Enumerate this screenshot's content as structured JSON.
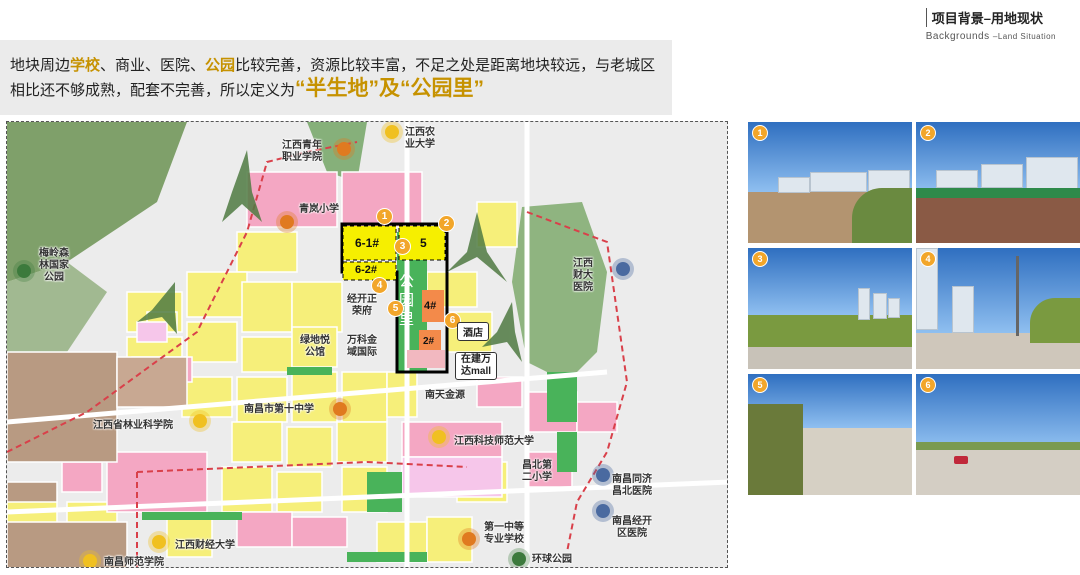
{
  "header": {
    "title": "项目背景–用地现状",
    "subtitle_main": "Backgrounds",
    "subtitle_small": "–Land Situation"
  },
  "intro": {
    "t1": "地块周边",
    "h1": "学校",
    "t2": "、商业、医院、",
    "h2": "公园",
    "t3": "比较完善，资源比较丰富，不足之处是距离地块较远，与老城区",
    "t4": "相比还不够成熟，配套不完善，所以定义为",
    "q1": "“半生地”",
    "t5": "及",
    "q2": "“公园里”"
  },
  "map": {
    "labels": {
      "jxqn": "江西青年\n职业学院",
      "jxny": "江西农\n业大学",
      "qlxx": "青岚小学",
      "mlsl": "梅岭森\n林国家\n公园",
      "jxcd": "江西\n财大\n医院",
      "jkzr": "经开正\n荣府",
      "ldyg": "绿地悦\n公馆",
      "wkjy": "万科金\n域国际",
      "ntjy": "南天金源",
      "ncsz": "南昌市第十中学",
      "jxly": "江西省林业科学院",
      "jxkj": "江西科技师范大学",
      "cbde": "昌北第\n二小学",
      "nctj": "南昌同济\n昌北医院",
      "ncjk": "南昌经开\n区医院",
      "dyzd": "第一中等\n专业学校",
      "jxcj": "江西财经大学",
      "ncsf": "南昌师范学院",
      "hqgy": "环球公园"
    },
    "plots": [
      "6-1#",
      "5",
      "6-2#",
      "4#",
      "2#"
    ],
    "park_text": "公\n园\n里",
    "tags": {
      "hotel": "酒店",
      "wanda": "在建万\n达mall"
    },
    "markers": [
      "1",
      "2",
      "3",
      "4",
      "5",
      "6"
    ]
  },
  "photos": [
    {
      "num": "1",
      "scene": "construction-site"
    },
    {
      "num": "2",
      "scene": "sports-field"
    },
    {
      "num": "3",
      "scene": "road-highrise"
    },
    {
      "num": "4",
      "scene": "street-pole"
    },
    {
      "num": "5",
      "scene": "tree-lined-road"
    },
    {
      "num": "6",
      "scene": "open-road"
    }
  ],
  "colors": {
    "accent": "#c69200",
    "marker": "#f2a62a",
    "residential": "#f6ef7a",
    "commercial": "#f4a7c3",
    "green": "#49b35a",
    "education": "#f6c6ea"
  }
}
